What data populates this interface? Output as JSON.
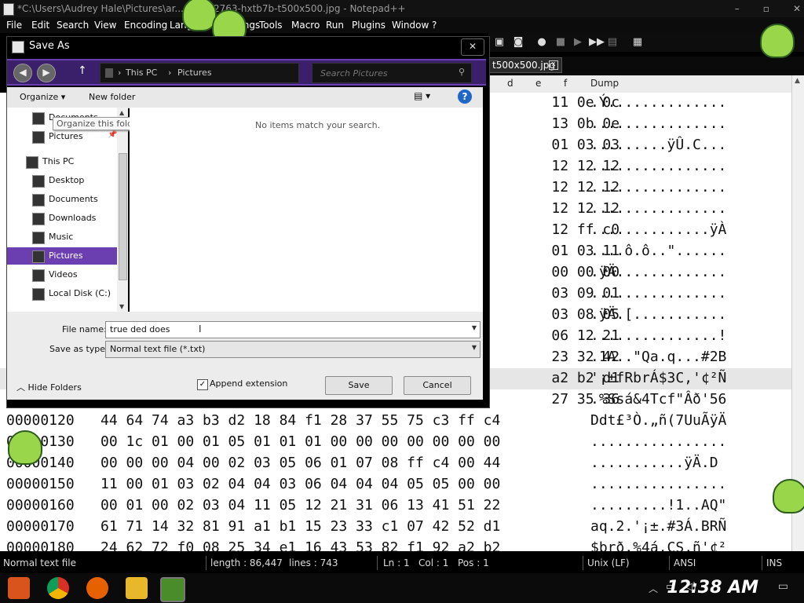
{
  "app": {
    "title": "*C:\\Users\\Audrey Hale\\Pictures\\ar...189422763-hxtb7b-t500x500.jpg - Notepad++",
    "menu": [
      "File",
      "Edit",
      "Search",
      "View",
      "Encoding",
      "Language",
      "Settings",
      "Tools",
      "Macro",
      "Run",
      "Plugins",
      "Window",
      "?"
    ],
    "window_buttons": [
      "–",
      "▫",
      "✕"
    ]
  },
  "tab": {
    "label": "t500x500.jpg",
    "close": "x"
  },
  "hex": {
    "headers": [
      "d",
      "e",
      "f",
      "Dump"
    ],
    "rows": [
      {
        "addr": "",
        "bytes": "                                                     11 0e 0c",
        "dump": ".Ý.............."
      },
      {
        "addr": "",
        "bytes": "                                                     13 0b 0e",
        "dump": "................"
      },
      {
        "addr": "",
        "bytes": "                                                     01 03 03",
        "dump": ".........ÿÛ.C..."
      },
      {
        "addr": "",
        "bytes": "                                                     12 12 12",
        "dump": "................"
      },
      {
        "addr": "",
        "bytes": "                                                     12 12 12",
        "dump": "................"
      },
      {
        "addr": "",
        "bytes": "                                                     12 12 12",
        "dump": "................"
      },
      {
        "addr": "",
        "bytes": "                                                     12 ff c0",
        "dump": "..............ÿÀ"
      },
      {
        "addr": "",
        "bytes": "                                                     01 03 11",
        "dump": "....ô.ô..\"......"
      },
      {
        "addr": "",
        "bytes": "                                                     00 00 00",
        "dump": ".ÿÄ............."
      },
      {
        "addr": "",
        "bytes": "                                                     03 09 01",
        "dump": "................"
      },
      {
        "addr": "",
        "bytes": "                                                     03 08 05",
        "dump": ".ÿÄ.[..........."
      },
      {
        "addr": "",
        "bytes": "                                                     06 12 21",
        "dump": "...............!"
      },
      {
        "addr": "",
        "bytes": "                                                     23 32 42",
        "dump": ".1A..\"Qa.q...#2B"
      },
      {
        "addr": "",
        "bytes": "                                                     a2 b2 d1",
        "dump": "'¡±fRbrÁ$3C,'¢²Ñ",
        "hl": true
      },
      {
        "addr": "",
        "bytes": "                                                     27 35 36",
        "dump": ".%Ssá&4Tcf\"Âð'56"
      },
      {
        "addr": "00000120",
        "bytes": "44 64 74 a3 b3 d2 18 84 f1 28 37 55 75 c3 ff c4",
        "dump": "Ddt£³Ò.„ñ(7UuÃÿÄ"
      },
      {
        "addr": "00000130",
        "bytes": "00 1c 01 00 01 05 01 01 01 00 00 00 00 00 00 00",
        "dump": "................"
      },
      {
        "addr": "00000140",
        "bytes": "00 00 00 04 00 02 03 05 06 01 07 08 ff c4 00 44",
        "dump": "...........ÿÄ.D"
      },
      {
        "addr": "00000150",
        "bytes": "11 00 01 03 02 04 04 03 06 04 04 04 05 05 00 00",
        "dump": "................"
      },
      {
        "addr": "00000160",
        "bytes": "00 01 00 02 03 04 11 05 12 21 31 06 13 41 51 22",
        "dump": ".........!1..AQ\""
      },
      {
        "addr": "00000170",
        "bytes": "61 71 14 32 81 91 a1 b1 15 23 33 c1 07 42 52 d1",
        "dump": "aq.2.'¡±.#3Á.BRÑ"
      },
      {
        "addr": "00000180",
        "bytes": "24 62 72 f0 08 25 34 e1 16 43 53 82 f1 92 a2 b2",
        "dump": "$brð.%4á.CS‚ñ'¢²"
      }
    ]
  },
  "status": {
    "filetype": "Normal text file",
    "length": "length : 86,447",
    "lines": "lines : 743",
    "ln": "Ln : 1",
    "col": "Col : 1",
    "pos": "Pos : 1",
    "eol": "Unix (LF)",
    "enc": "ANSI",
    "ins": "INS"
  },
  "taskbar": {
    "clock": "12:38 AM"
  },
  "dialog": {
    "title": "Save As",
    "close": "✕",
    "breadcrumb": [
      "This PC",
      "Pictures"
    ],
    "search_placeholder": "Search Pictures",
    "organize": "Organize ▾",
    "new_folder": "New folder",
    "help": "?",
    "tooltip": "Organize this folder's contents.",
    "nav_items": [
      {
        "label": "Documents",
        "icon": "folder-icon"
      },
      {
        "label": "Pictures",
        "icon": "pictures-icon"
      },
      {
        "label": "This PC",
        "icon": "computer-icon"
      },
      {
        "label": "Desktop",
        "icon": "desktop-icon"
      },
      {
        "label": "Documents",
        "icon": "documents-icon"
      },
      {
        "label": "Downloads",
        "icon": "downloads-icon"
      },
      {
        "label": "Music",
        "icon": "music-icon"
      },
      {
        "label": "Pictures",
        "icon": "pictures-icon"
      },
      {
        "label": "Videos",
        "icon": "videos-icon"
      },
      {
        "label": "Local Disk (C:)",
        "icon": "disk-icon"
      }
    ],
    "empty_message": "No items match your search.",
    "filename_label": "File name:",
    "filename_value": "true ded does",
    "savetype_label": "Save as type:",
    "savetype_value": "Normal text file (*.txt)",
    "hide_folders": "Hide Folders",
    "append_extension": "Append extension",
    "append_checked": "✓",
    "save": "Save",
    "cancel": "Cancel"
  }
}
